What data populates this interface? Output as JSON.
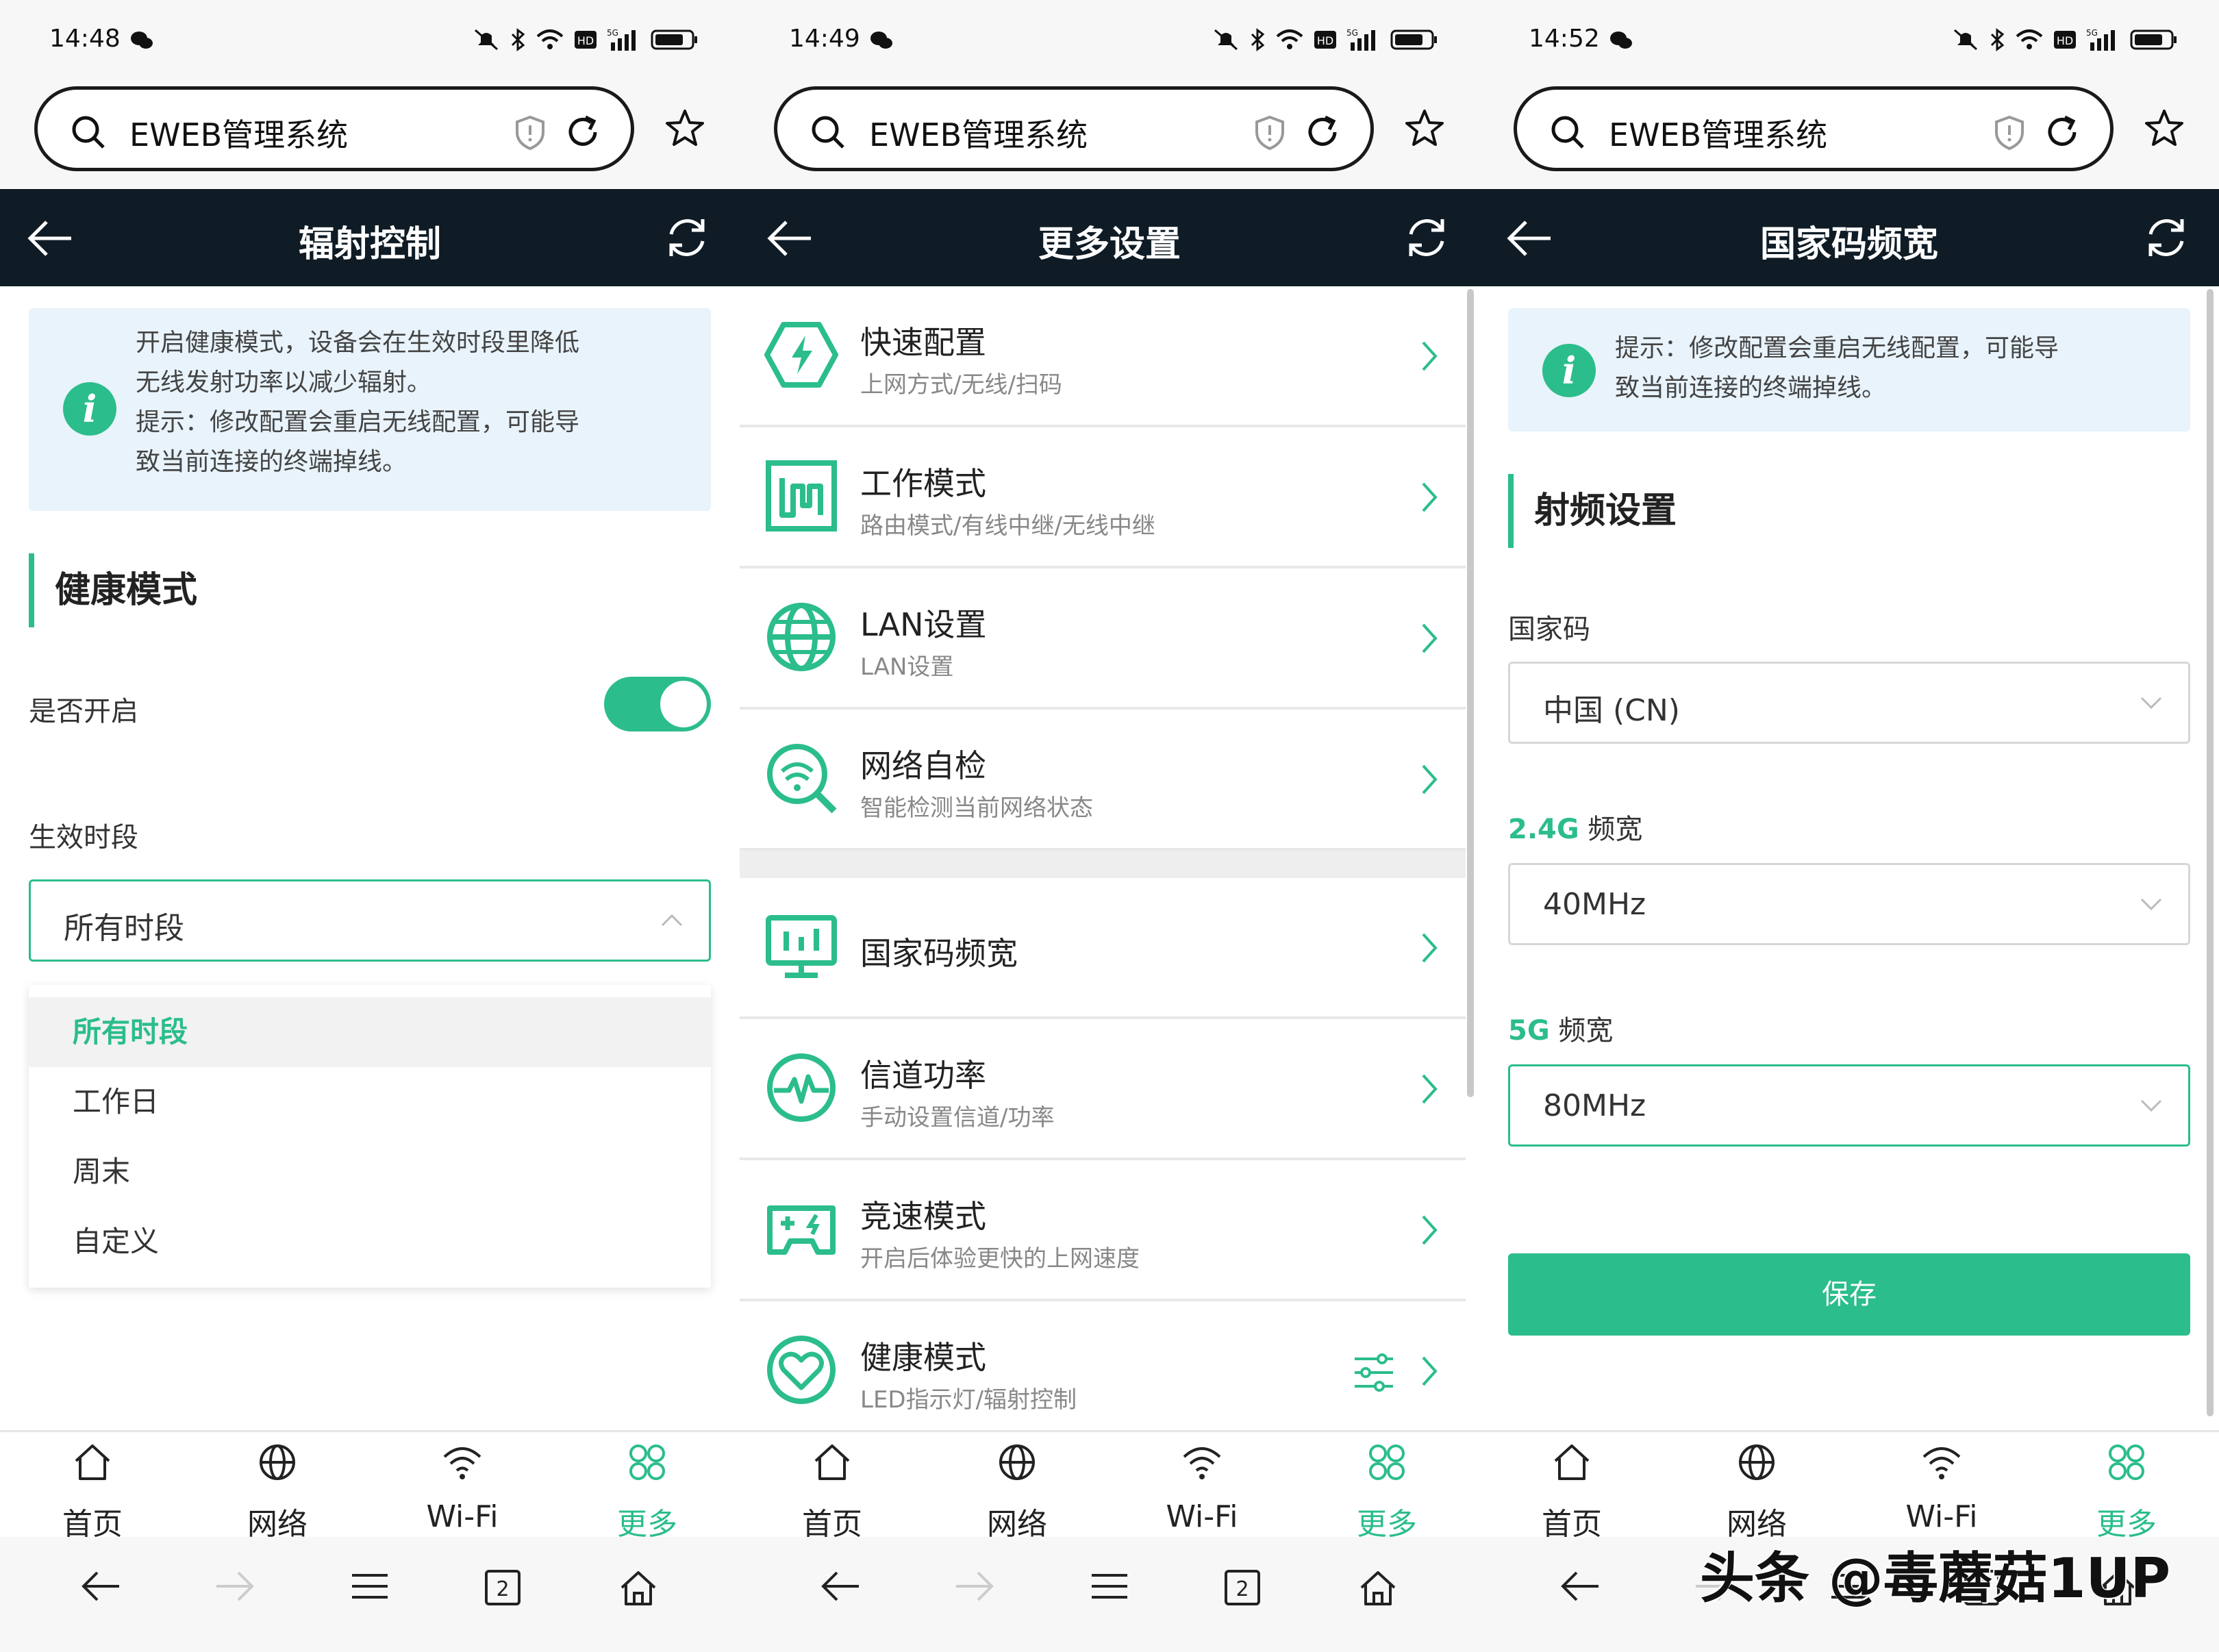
{
  "panels": [
    {
      "status_time": "14:48",
      "url": "EWEB管理系统",
      "title": "辐射控制",
      "alert": {
        "line1": "开启健康模式，设备会在生效时段里降低",
        "line2": "无线发射功率以减少辐射。",
        "line3": "提示：修改配置会重启无线配置，可能导",
        "line4": "致当前连接的终端掉线。"
      },
      "section": "健康模式",
      "enable_label": "是否开启",
      "enabled": true,
      "period_label": "生效时段",
      "period_value": "所有时段",
      "period_options": [
        "所有时段",
        "工作日",
        "周末",
        "自定义"
      ]
    },
    {
      "status_time": "14:49",
      "url": "EWEB管理系统",
      "title": "更多设置",
      "menu": [
        {
          "title": "快速配置",
          "sub": "上网方式/无线/扫码",
          "icon": "lightning-hexagon-icon"
        },
        {
          "title": "工作模式",
          "sub": "路由模式/有线中继/无线中继",
          "icon": "work-mode-icon"
        },
        {
          "title": "LAN设置",
          "sub": "LAN设置",
          "icon": "globe-icon"
        },
        {
          "title": "网络自检",
          "sub": "智能检测当前网络状态",
          "icon": "network-check-icon"
        },
        {
          "title": "国家码频宽",
          "sub": "",
          "icon": "monitor-chart-icon"
        },
        {
          "title": "信道功率",
          "sub": "手动设置信道/功率",
          "icon": "pulse-icon"
        },
        {
          "title": "竞速模式",
          "sub": "开启后体验更快的上网速度",
          "icon": "gamepad-icon"
        },
        {
          "title": "健康模式",
          "sub": "LED指示灯/辐射控制",
          "icon": "heart-icon"
        }
      ]
    },
    {
      "status_time": "14:52",
      "url": "EWEB管理系统",
      "title": "国家码频宽",
      "alert": {
        "line1": "提示：修改配置会重启无线配置，可能导",
        "line2": "致当前连接的终端掉线。"
      },
      "section": "射频设置",
      "country_label": "国家码",
      "country_value": "中国 (CN)",
      "bw24_prefix": "2.4G",
      "bw24_suffix": " 频宽",
      "bw24_value": "40MHz",
      "bw5_prefix": "5G",
      "bw5_suffix": " 频宽",
      "bw5_value": "80MHz",
      "save": "保存"
    }
  ],
  "tabs": [
    {
      "label": "首页",
      "icon": "home-icon"
    },
    {
      "label": "网络",
      "icon": "globe-icon"
    },
    {
      "label": "Wi-Fi",
      "icon": "wifi-icon"
    },
    {
      "label": "更多",
      "icon": "more-grid-icon"
    }
  ],
  "browser_tab_count": "2",
  "watermark": "头条 @毒蘑菇1UP",
  "colors": {
    "accent": "#2bbd8b",
    "appbar": "#0f1c26",
    "alert_bg": "#e8f3fb"
  }
}
